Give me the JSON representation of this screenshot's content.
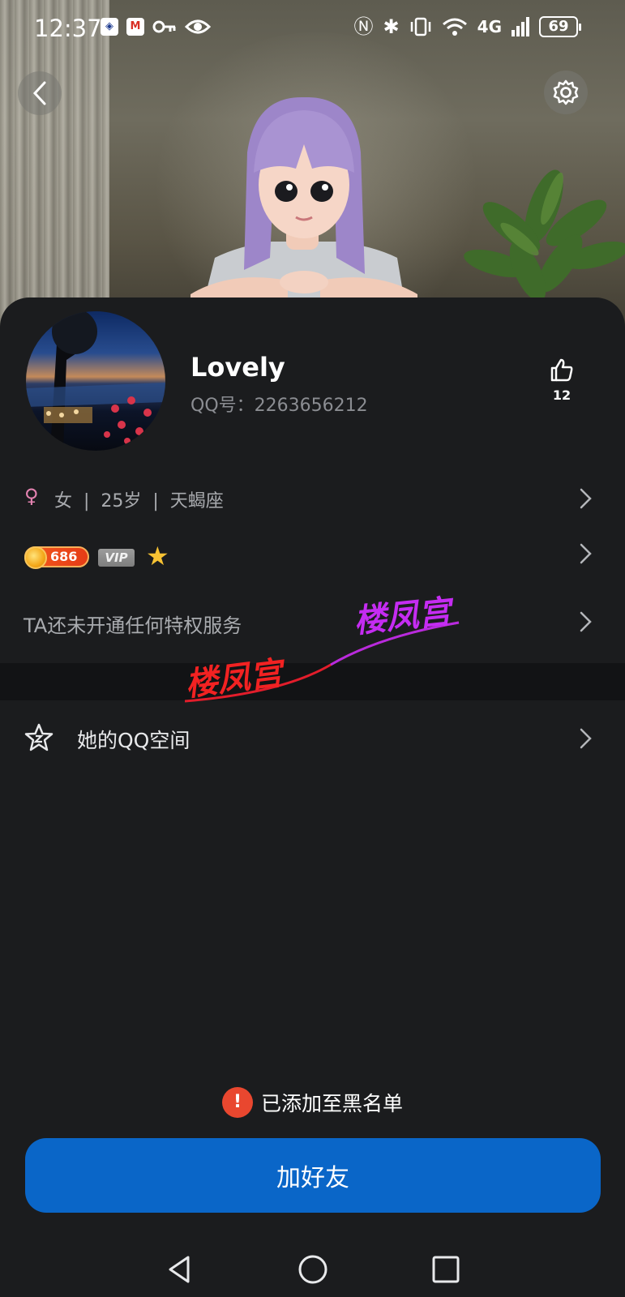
{
  "status_bar": {
    "time": "12:37",
    "battery": "69",
    "network": "4G"
  },
  "profile": {
    "name": "Lovely",
    "qq_label": "QQ号：",
    "qq_number": "2263656212",
    "like_count": "12"
  },
  "info": {
    "gender_symbol": "♀",
    "text": "女  |  25岁  |  天蝎座"
  },
  "badges": {
    "coin_value": "686",
    "vip_label": "VIP",
    "star_icon": "star-icon"
  },
  "privilege": {
    "text": "TA还未开通任何特权服务"
  },
  "qzone": {
    "label": "她的QQ空间"
  },
  "watermark": {
    "text_red": "楼凤宫",
    "text_purple": "楼凤宫"
  },
  "notice": {
    "blacklist_text": "已添加至黑名单",
    "warning_icon": "exclamation-icon"
  },
  "actions": {
    "add_friend": "加好友"
  },
  "colors": {
    "primary_button": "#0a66c8",
    "card_bg": "#1b1c1e",
    "warning": "#e9472f",
    "gender_female": "#e483b1",
    "coin_badge": "#e53b16"
  }
}
